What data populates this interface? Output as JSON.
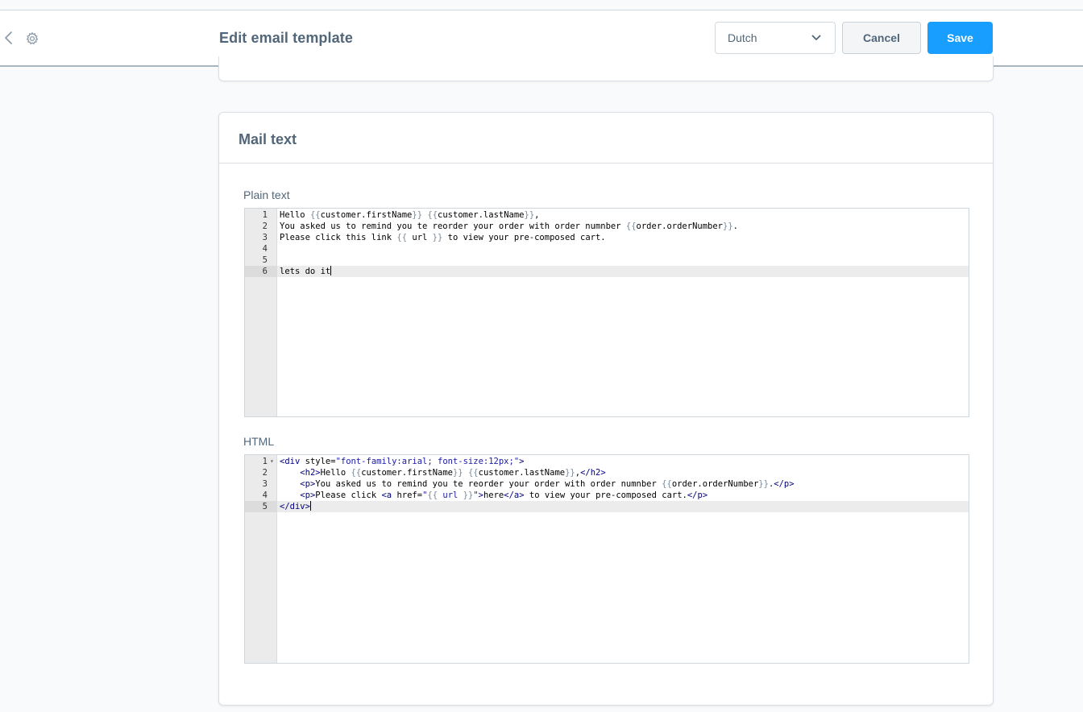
{
  "header": {
    "title": "Edit email template",
    "language_selected": "Dutch",
    "cancel_label": "Cancel",
    "save_label": "Save"
  },
  "card": {
    "title": "Mail text",
    "plain_label": "Plain text",
    "html_label": "HTML"
  },
  "plain_lines": [
    {
      "n": "1",
      "text": "Hello {{customer.firstName}} {{customer.lastName}},"
    },
    {
      "n": "2",
      "text": "You asked us to remind you te reorder your order with order numnber {{order.orderNumber}}."
    },
    {
      "n": "3",
      "text": "Please click this link {{ url }} to view your pre-composed cart."
    },
    {
      "n": "4",
      "text": ""
    },
    {
      "n": "5",
      "text": ""
    },
    {
      "n": "6",
      "text": "lets do it"
    }
  ],
  "html_lines": [
    {
      "n": "1",
      "text": "<div style=\"font-family:arial; font-size:12px;\">"
    },
    {
      "n": "2",
      "text": "    <h2>Hello {{customer.firstName}} {{customer.lastName}},</h2>"
    },
    {
      "n": "3",
      "text": "    <p>You asked us to remind you te reorder your order with order numnber {{order.orderNumber}}.</p>"
    },
    {
      "n": "4",
      "text": "    <p>Please click <a href=\"{{ url }}\">here</a> to view your pre-composed cart.</p>"
    },
    {
      "n": "5",
      "text": "</div>"
    }
  ],
  "colors": {
    "primary": "#189eff",
    "text": "#52667a"
  },
  "icons": {
    "back": "chevron-left-icon",
    "settings": "gear-icon",
    "dropdown": "chevron-down-icon",
    "fold": "fold-arrow-icon"
  }
}
